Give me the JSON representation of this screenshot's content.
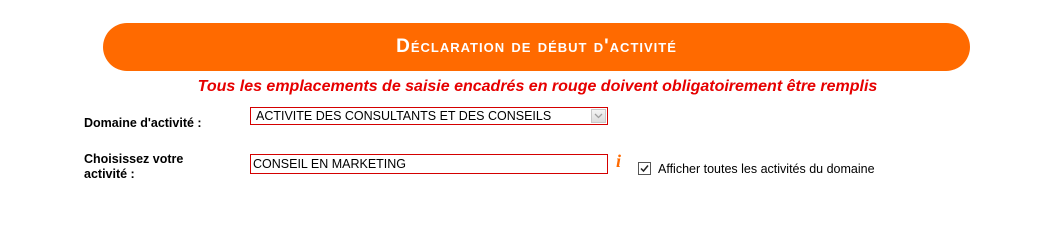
{
  "banner": {
    "title": "Déclaration de début d'activité"
  },
  "notice": "Tous les emplacements de saisie encadrés en rouge doivent obligatoirement être remplis",
  "form": {
    "domain_label": "Domaine d'activité :",
    "domain_value": "ACTIVITE DES CONSULTANTS ET DES CONSEILS",
    "activity_label": "Choisissez votre activité :",
    "activity_value": "CONSEIL EN MARKETING",
    "info_icon_glyph": "i",
    "show_all_label": "Afficher toutes les activités du domaine",
    "show_all_checked": true
  },
  "colors": {
    "banner": "#ff6a00",
    "notice": "#e60000",
    "required_border": "#d40000",
    "info_icon": "#ff6a00"
  },
  "icons": {
    "dropdown": "chevron-down-icon",
    "info": "info-icon",
    "check": "checkmark-icon"
  }
}
